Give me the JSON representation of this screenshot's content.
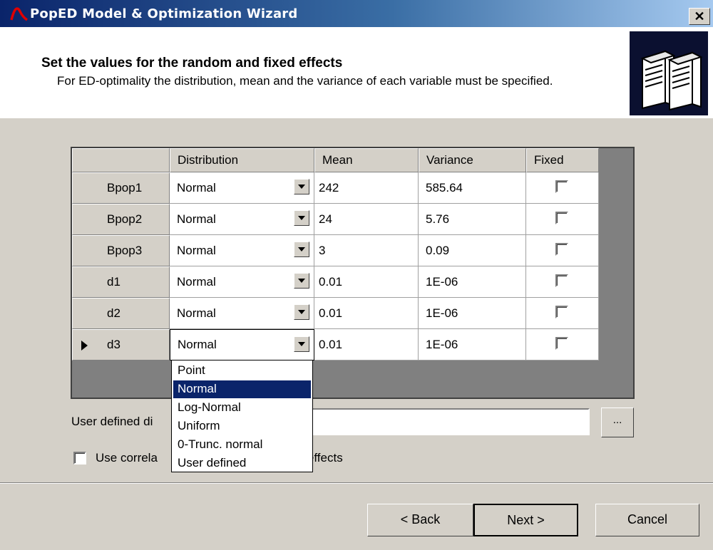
{
  "window": {
    "title": "PopED Model & Optimization Wizard",
    "close_glyph": "✕"
  },
  "header": {
    "title": "Set the values for the random and fixed effects",
    "description": "For ED-optimality the distribution, mean and the variance of each variable must be specified."
  },
  "grid": {
    "columns": [
      "Distribution",
      "Mean",
      "Variance",
      "Fixed"
    ],
    "rows": [
      {
        "name": "Bpop1",
        "distribution": "Normal",
        "mean": "242",
        "variance": "585.64",
        "fixed": false
      },
      {
        "name": "Bpop2",
        "distribution": "Normal",
        "mean": "24",
        "variance": "5.76",
        "fixed": false
      },
      {
        "name": "Bpop3",
        "distribution": "Normal",
        "mean": "3",
        "variance": "0.09",
        "fixed": false
      },
      {
        "name": "d1",
        "distribution": "Normal",
        "mean": "0.01",
        "variance": "1E-06",
        "fixed": false
      },
      {
        "name": "d2",
        "distribution": "Normal",
        "mean": "0.01",
        "variance": "1E-06",
        "fixed": false
      },
      {
        "name": "d3",
        "distribution": "Normal",
        "mean": "0.01",
        "variance": "1E-06",
        "fixed": false
      }
    ],
    "current_row_index": 5
  },
  "dropdown": {
    "options": [
      "Point",
      "Normal",
      "Log-Normal",
      "Uniform",
      "0-Trunc. normal",
      "User defined"
    ],
    "selected": "Normal"
  },
  "user_defined": {
    "label_visible": "User defined di",
    "value": "",
    "browse_label": "..."
  },
  "correlation": {
    "label_left": "Use correla",
    "label_right": "effects",
    "checked": false
  },
  "buttons": {
    "back": "< Back",
    "next": "Next >",
    "cancel": "Cancel"
  },
  "colors": {
    "title_bar_start": "#0a246a",
    "selection": "#0a246a",
    "face": "#d4d0c8"
  }
}
